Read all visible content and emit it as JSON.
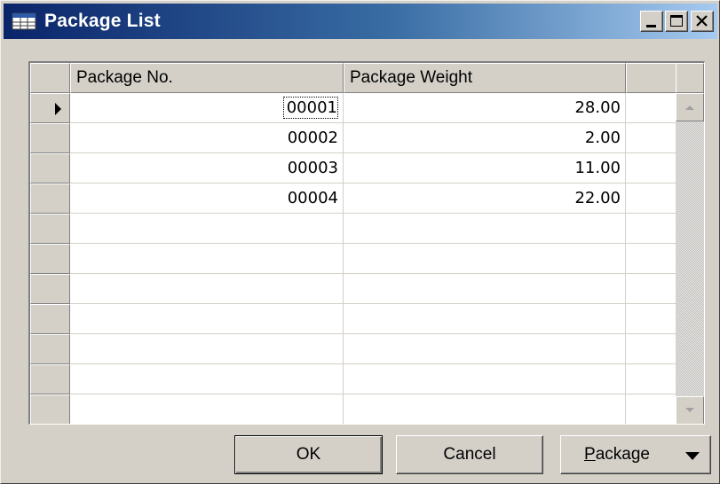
{
  "window": {
    "title": "Package List"
  },
  "grid": {
    "columns": [
      "Package No.",
      "Package Weight",
      ""
    ],
    "rows": [
      {
        "package_no": "00001",
        "package_weight": "28.00",
        "selected": true
      },
      {
        "package_no": "00002",
        "package_weight": "2.00",
        "selected": false
      },
      {
        "package_no": "00003",
        "package_weight": "11.00",
        "selected": false
      },
      {
        "package_no": "00004",
        "package_weight": "22.00",
        "selected": false
      },
      {
        "package_no": "",
        "package_weight": "",
        "selected": false
      },
      {
        "package_no": "",
        "package_weight": "",
        "selected": false
      },
      {
        "package_no": "",
        "package_weight": "",
        "selected": false
      },
      {
        "package_no": "",
        "package_weight": "",
        "selected": false
      },
      {
        "package_no": "",
        "package_weight": "",
        "selected": false
      },
      {
        "package_no": "",
        "package_weight": "",
        "selected": false
      },
      {
        "package_no": "",
        "package_weight": "",
        "selected": false
      }
    ]
  },
  "buttons": {
    "ok": "OK",
    "cancel": "Cancel",
    "package_first": "P",
    "package_rest": "ackage"
  },
  "colors": {
    "titlebar_start": "#0a246a",
    "titlebar_end": "#a6caf0",
    "face": "#d4d0c8"
  },
  "icons": {
    "window": "table-icon",
    "minimize": "minimize-icon",
    "maximize": "maximize-icon",
    "close": "close-icon",
    "scroll_up": "arrow-up-icon",
    "scroll_down": "arrow-down-icon",
    "row_pointer": "row-pointer-icon",
    "dropdown": "chevron-down-icon"
  }
}
